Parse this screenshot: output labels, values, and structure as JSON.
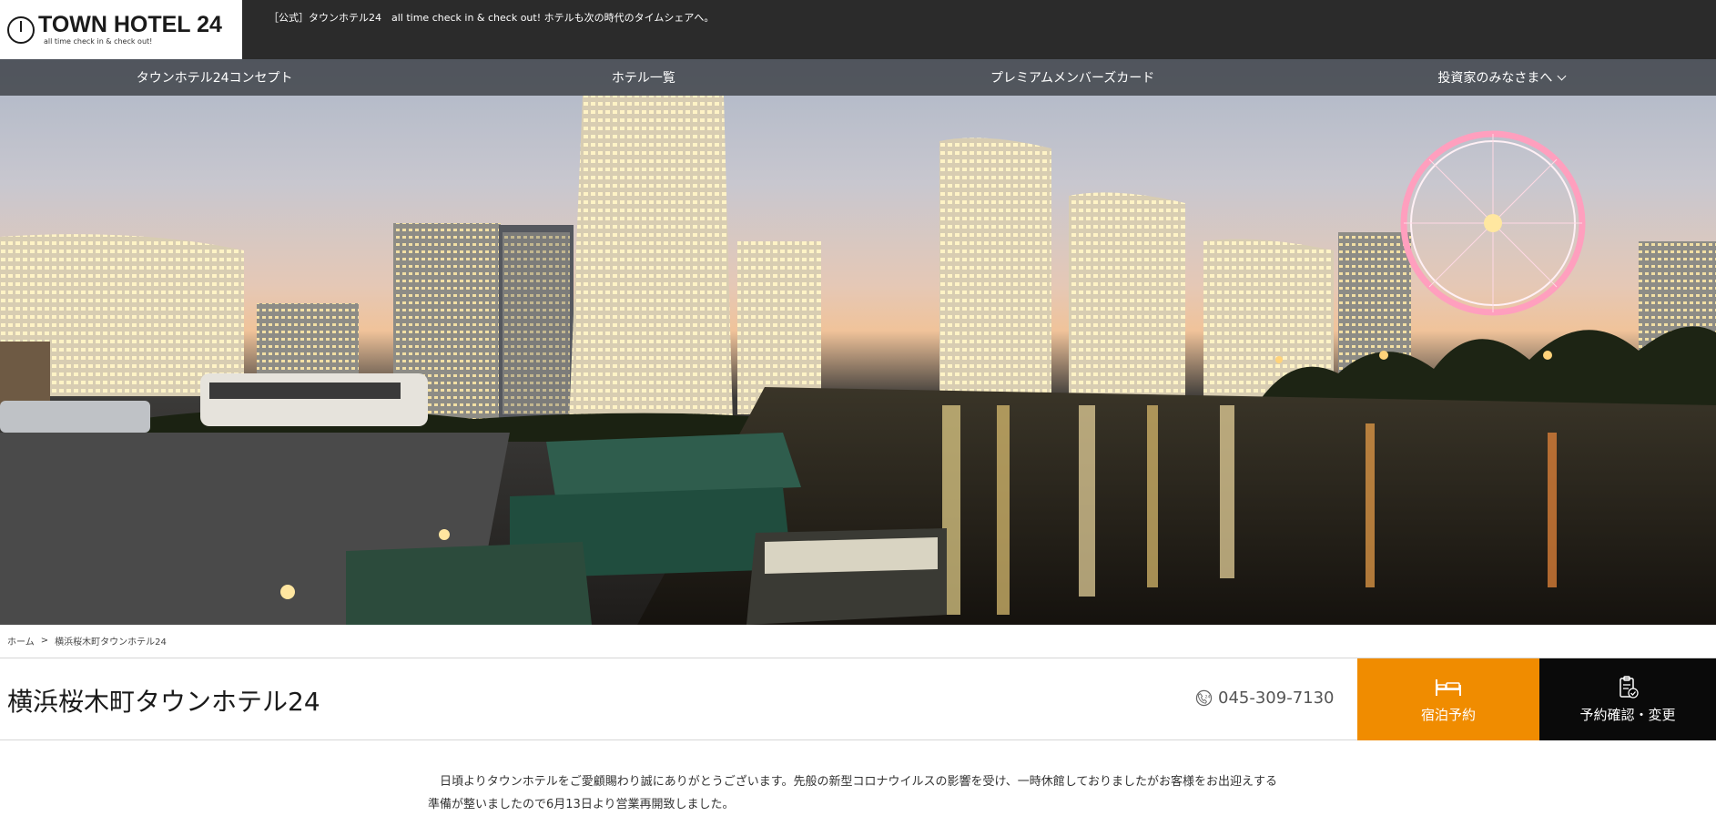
{
  "header": {
    "logo": {
      "name": "TOWN HOTEL 24",
      "tagline": "all time check in & check out!"
    },
    "tagline": "［公式］タウンホテル24　all time check in & check out! ホテルも次の時代のタイムシェアへ。"
  },
  "nav": {
    "items": [
      {
        "label": "タウンホテル24コンセプト"
      },
      {
        "label": "ホテル一覧"
      },
      {
        "label": "プレミアムメンバーズカード"
      },
      {
        "label": "投資家のみなさまへ",
        "icon": "chevron-down-icon"
      }
    ]
  },
  "hero": {
    "image": "yokohama-minatomirai-night-skyline"
  },
  "breadcrumb": {
    "home": "ホーム",
    "separator": ">",
    "current": "横浜桜木町タウンホテル24"
  },
  "hotel": {
    "title": "横浜桜木町タウンホテル24",
    "phone": "045-309-7130",
    "phone_icon": "phone-24-icon"
  },
  "actions": {
    "stay_label": "宿泊予約",
    "stay_icon": "bed-icon",
    "confirm_label": "予約確認・変更",
    "confirm_icon": "clipboard-check-icon"
  },
  "notice": {
    "line1": "日頃よりタウンホテルをご愛顧賜わり誠にありがとうございます。先般の新型コロナウイルスの影響を受け、一時休館しておりましたがお客様をお出迎えする",
    "line2": "準備が整いましたので6月13日より営業再開致しました。"
  },
  "colors": {
    "topbar": "#2b2b2b",
    "nav_overlay": "#3c4046",
    "stay_button": "#f08c00",
    "confirm_button": "#0a0a0a"
  }
}
